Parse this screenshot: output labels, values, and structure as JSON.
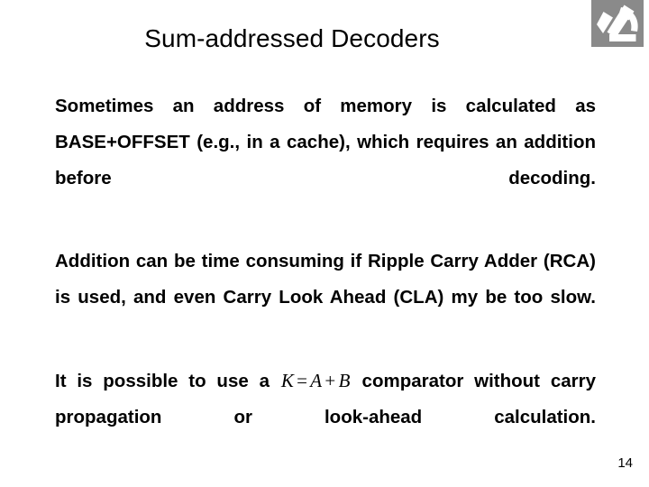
{
  "slide": {
    "title": "Sum-addressed Decoders",
    "page_number": "14",
    "logo": {
      "name": "microscope-logo",
      "background_color": "#8a8a8a",
      "glyph_color": "#ffffff"
    },
    "background_color": "#ffffff",
    "text_color": "#000000"
  },
  "body": {
    "paragraphs": [
      {
        "id": "p1",
        "text": "Sometimes an address of memory is calculated as BASE+OFFSET (e.g., in a cache), which requires an addition before decoding."
      },
      {
        "id": "p2",
        "text": "Addition can be time consuming if Ripple Carry Adder (RCA) is used, and even Carry Look Ahead (CLA) my be too slow."
      },
      {
        "id": "p3",
        "lead": "It is possible to use a ",
        "math": {
          "lhs": "K",
          "eq": "=",
          "rhs_a": "A",
          "plus": "+",
          "rhs_b": "B"
        },
        "tail": " comparator without carry propagation or look-ahead calculation."
      }
    ]
  }
}
